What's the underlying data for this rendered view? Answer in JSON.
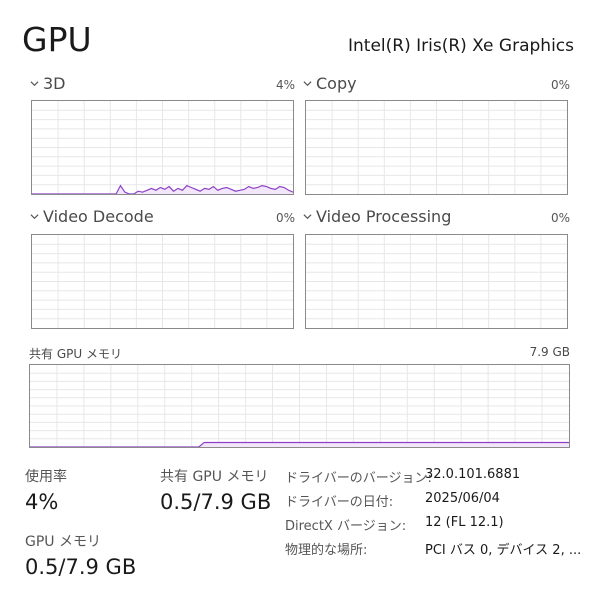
{
  "header": {
    "title": "GPU",
    "adapter_name": "Intel(R) Iris(R) Xe Graphics"
  },
  "engines": [
    {
      "label": "3D",
      "percent": "4%"
    },
    {
      "label": "Copy",
      "percent": "0%"
    },
    {
      "label": "Video Decode",
      "percent": "0%"
    },
    {
      "label": "Video Processing",
      "percent": "0%"
    }
  ],
  "shared_memory_graph": {
    "label": "共有 GPU メモリ",
    "capacity": "7.9 GB"
  },
  "stats": {
    "utilization_label": "使用率",
    "utilization_value": "4%",
    "shared_memory_label": "共有 GPU メモリ",
    "shared_memory_value": "0.5/7.9 GB",
    "gpu_memory_label": "GPU メモリ",
    "gpu_memory_value": "0.5/7.9 GB"
  },
  "info": [
    {
      "label": "ドライバーのバージョン:",
      "value": "32.0.101.6881"
    },
    {
      "label": "ドライバーの日付:",
      "value": "2025/06/04"
    },
    {
      "label": "DirectX バージョン:",
      "value": "12 (FL 12.1)"
    },
    {
      "label": "物理的な場所:",
      "value": "PCI バス 0, デバイス 2, ..."
    }
  ],
  "chart_data": [
    {
      "type": "area",
      "series": [
        {
          "values": [
            0,
            0,
            0,
            0,
            0,
            0,
            0,
            0,
            0,
            0,
            0,
            0,
            0,
            0,
            0,
            0,
            0,
            0,
            0,
            0,
            0,
            0,
            0,
            0,
            0,
            0,
            0,
            0,
            0,
            0,
            0,
            0,
            0,
            0,
            0,
            0,
            0,
            0,
            0,
            0,
            0,
            0,
            0,
            0,
            0,
            0,
            0,
            0,
            0,
            0,
            0,
            0,
            0,
            0,
            0,
            0,
            0,
            0,
            0,
            0,
            0,
            0,
            0,
            0,
            0,
            0,
            0,
            0,
            0,
            0,
            0,
            0,
            0,
            0,
            0,
            0,
            0,
            0,
            0,
            0,
            0,
            0,
            0,
            0,
            0,
            0,
            0,
            0,
            0,
            0,
            0,
            0,
            0,
            0,
            0,
            0,
            0,
            0,
            0,
            0,
            0,
            0,
            0,
            0,
            0,
            0,
            0,
            0,
            0,
            0,
            0,
            0,
            0,
            0,
            0,
            0,
            0,
            0,
            0,
            0,
            0,
            0,
            0,
            0,
            0,
            0,
            0,
            0,
            0,
            0,
            0,
            0,
            0,
            0,
            0,
            0,
            0,
            0,
            0,
            0,
            0,
            0,
            0,
            0,
            0,
            0,
            0,
            0,
            0,
            0,
            0,
            0,
            0,
            0,
            0,
            0,
            0,
            0,
            0,
            0,
            0,
            0,
            0,
            0,
            0,
            0,
            0,
            0,
            0,
            0,
            0,
            0,
            0,
            0,
            0,
            0,
            0,
            0,
            0,
            0,
            0,
            0,
            0,
            0,
            0,
            0,
            0,
            0,
            0,
            0,
            0,
            0,
            0,
            0,
            0,
            0,
            0,
            0,
            0,
            0
          ]
        }
      ],
      "ylim": [
        0,
        100
      ]
    }
  ],
  "colors": {
    "line": "#8e40c7",
    "fill": "#f1e6fa",
    "grid": "#e7e7e7",
    "border": "#8a8a8a"
  }
}
